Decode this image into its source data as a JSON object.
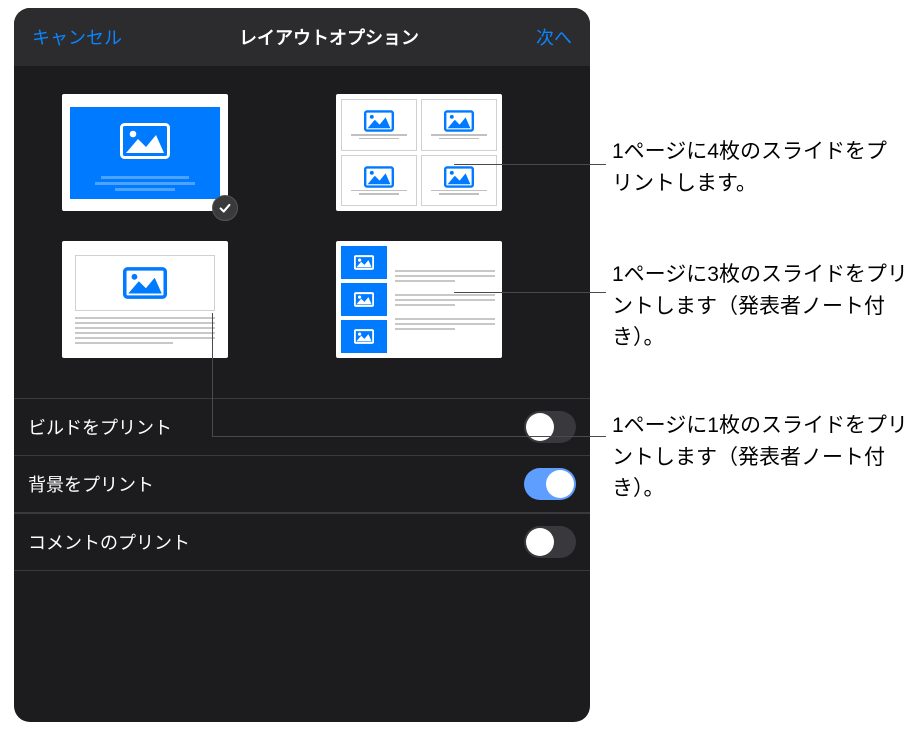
{
  "header": {
    "cancel": "キャンセル",
    "title": "レイアウトオプション",
    "next": "次へ"
  },
  "layouts": {
    "single": {
      "selected": true
    },
    "four_up": {
      "selected": false
    },
    "one_with_notes": {
      "selected": false
    },
    "three_with_notes": {
      "selected": false
    }
  },
  "toggles": [
    {
      "label": "ビルドをプリント",
      "on": false
    },
    {
      "label": "背景をプリント",
      "on": true
    },
    {
      "label": "コメントのプリント",
      "on": false
    }
  ],
  "callouts": {
    "four": "1ページに4枚のスライドをプリントします。",
    "three": "1ページに3枚のスライドをプリントします（発表者ノート付き）。",
    "one": "1ページに1枚のスライドをプリントします（発表者ノート付き）。"
  }
}
